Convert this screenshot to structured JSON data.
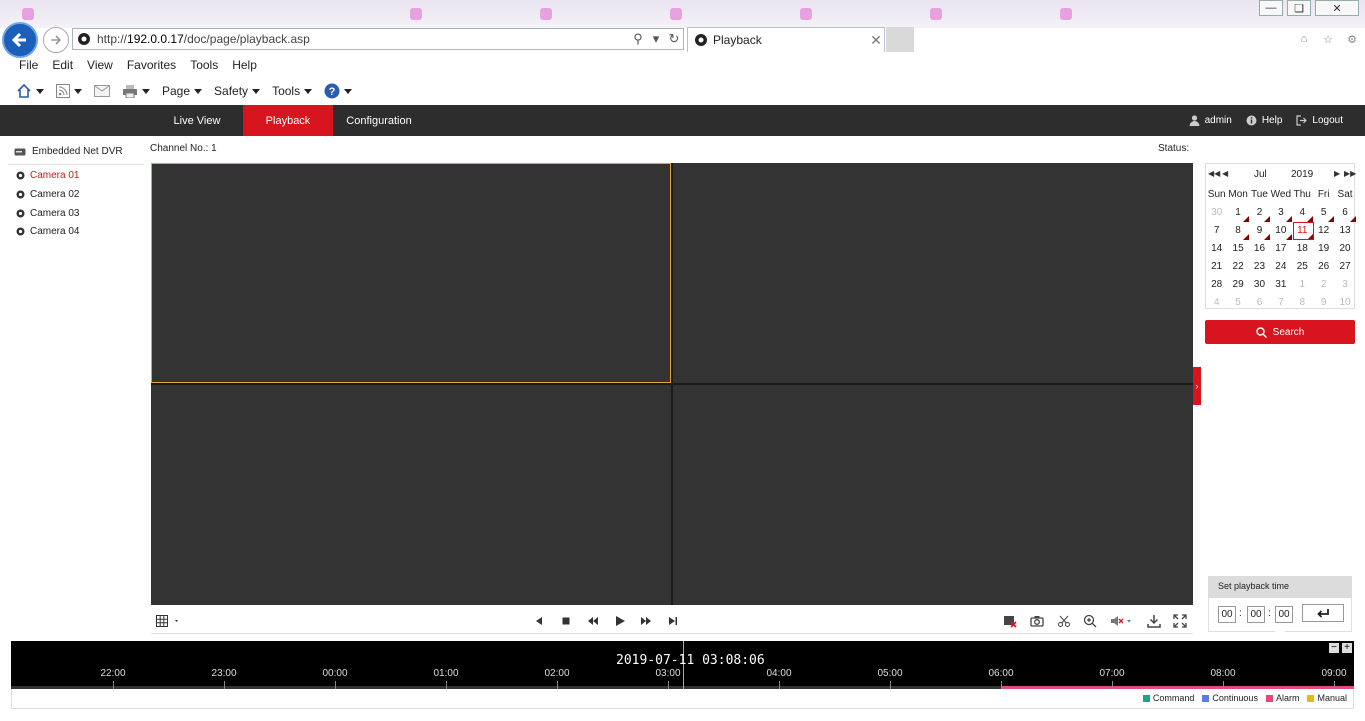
{
  "browser": {
    "url_prefix": "http://",
    "url_host": "192.0.0.17",
    "url_path": "/doc/page/playback.asp",
    "tab_title": "Playback",
    "menu": [
      "File",
      "Edit",
      "View",
      "Favorites",
      "Tools",
      "Help"
    ],
    "commands": [
      "Page",
      "Safety",
      "Tools"
    ]
  },
  "nav": {
    "tabs": [
      "Live View",
      "Playback",
      "Configuration"
    ],
    "active": "Playback",
    "user": "admin",
    "help": "Help",
    "logout": "Logout"
  },
  "sidebar": {
    "device": "Embedded Net DVR",
    "cameras": [
      "Camera 01",
      "Camera 02",
      "Camera 03",
      "Camera 04"
    ],
    "selected": "Camera 01"
  },
  "main": {
    "channel_label": "Channel No.: 1",
    "status_label": "Status:"
  },
  "calendar": {
    "month": "Jul",
    "year": "2019",
    "weekdays": [
      "Sun",
      "Mon",
      "Tue",
      "Wed",
      "Thu",
      "Fri",
      "Sat"
    ],
    "weeks": [
      [
        "30",
        "1",
        "2",
        "3",
        "4",
        "5",
        "6"
      ],
      [
        "7",
        "8",
        "9",
        "10",
        "11",
        "12",
        "13"
      ],
      [
        "14",
        "15",
        "16",
        "17",
        "18",
        "19",
        "20"
      ],
      [
        "21",
        "22",
        "23",
        "24",
        "25",
        "26",
        "27"
      ],
      [
        "28",
        "29",
        "30",
        "31",
        "1",
        "2",
        "3"
      ],
      [
        "4",
        "5",
        "6",
        "7",
        "8",
        "9",
        "10"
      ]
    ],
    "selected_day": "11",
    "recorded_days": [
      "1",
      "2",
      "3",
      "4",
      "5",
      "6",
      "8",
      "9",
      "10",
      "11"
    ]
  },
  "search": {
    "label": "Search"
  },
  "playback_time": {
    "title": "Set playback time",
    "hh": "00",
    "mm": "00",
    "ss": "00"
  },
  "timeline": {
    "current": "2019-07-11 03:08:06",
    "ticks": [
      "22:00",
      "23:00",
      "00:00",
      "01:00",
      "02:00",
      "03:00",
      "04:00",
      "05:00",
      "06:00",
      "07:00",
      "08:00",
      "09:00"
    ]
  },
  "legend": [
    {
      "label": "Command",
      "color": "#1aa589"
    },
    {
      "label": "Continuous",
      "color": "#5b7be0"
    },
    {
      "label": "Alarm",
      "color": "#e34a7a"
    },
    {
      "label": "Manual",
      "color": "#e8b81a"
    }
  ],
  "colors": {
    "accent": "#d8141e",
    "nav_bg": "#2d2d2d",
    "pane_bg": "#333333",
    "selected_pane": "#e0a82a"
  }
}
